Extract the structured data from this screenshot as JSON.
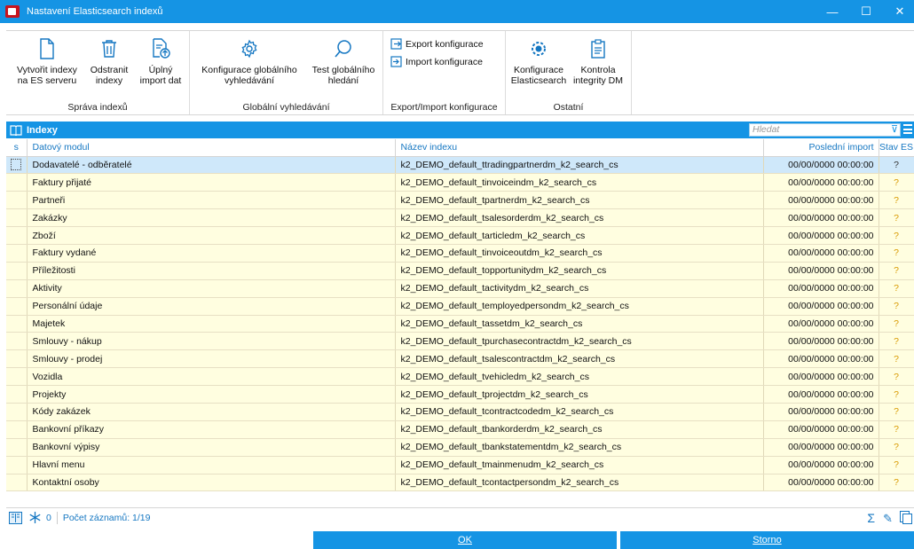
{
  "window": {
    "title": "Nastavení Elasticsearch indexů",
    "minimize": "—",
    "maximize": "☐",
    "close": "✕"
  },
  "ribbon": {
    "groups": [
      {
        "label": "Správa indexů",
        "buttons": [
          "Vytvořit indexy\nna ES serveru",
          "Odstranit\nindexy",
          "Úplný\nimport dat"
        ]
      },
      {
        "label": "Globální vyhledávání",
        "buttons": [
          "Konfigurace globálního\nvyhledávání",
          "Test globálního\nhledání"
        ]
      },
      {
        "label": "Export/Import konfigurace",
        "buttons": [
          "Export konfigurace",
          "Import konfigurace"
        ]
      },
      {
        "label": "Ostatní",
        "buttons": [
          "Konfigurace\nElasticsearch",
          "Kontrola\nintegrity DM"
        ]
      }
    ]
  },
  "grid": {
    "title": "Indexy",
    "search_placeholder": "Hledat",
    "columns": [
      "s",
      "Datový modul",
      "Název indexu",
      "Poslední import",
      "Stav ES"
    ],
    "rows": [
      {
        "modul": "Dodavatelé - odběratelé",
        "index": "k2_DEMO_default_ttradingpartnerdm_k2_search_cs",
        "import": "00/00/0000 00:00:00",
        "stav": "?"
      },
      {
        "modul": "Faktury přijaté",
        "index": "k2_DEMO_default_tinvoiceindm_k2_search_cs",
        "import": "00/00/0000 00:00:00",
        "stav": "?"
      },
      {
        "modul": "Partneři",
        "index": "k2_DEMO_default_tpartnerdm_k2_search_cs",
        "import": "00/00/0000 00:00:00",
        "stav": "?"
      },
      {
        "modul": "Zakázky",
        "index": "k2_DEMO_default_tsalesorderdm_k2_search_cs",
        "import": "00/00/0000 00:00:00",
        "stav": "?"
      },
      {
        "modul": "Zboží",
        "index": "k2_DEMO_default_tarticledm_k2_search_cs",
        "import": "00/00/0000 00:00:00",
        "stav": "?"
      },
      {
        "modul": "Faktury vydané",
        "index": "k2_DEMO_default_tinvoiceoutdm_k2_search_cs",
        "import": "00/00/0000 00:00:00",
        "stav": "?"
      },
      {
        "modul": "Příležitosti",
        "index": "k2_DEMO_default_topportunitydm_k2_search_cs",
        "import": "00/00/0000 00:00:00",
        "stav": "?"
      },
      {
        "modul": "Aktivity",
        "index": "k2_DEMO_default_tactivitydm_k2_search_cs",
        "import": "00/00/0000 00:00:00",
        "stav": "?"
      },
      {
        "modul": "Personální údaje",
        "index": "k2_DEMO_default_temployedpersondm_k2_search_cs",
        "import": "00/00/0000 00:00:00",
        "stav": "?"
      },
      {
        "modul": "Majetek",
        "index": "k2_DEMO_default_tassetdm_k2_search_cs",
        "import": "00/00/0000 00:00:00",
        "stav": "?"
      },
      {
        "modul": "Smlouvy - nákup",
        "index": "k2_DEMO_default_tpurchasecontractdm_k2_search_cs",
        "import": "00/00/0000 00:00:00",
        "stav": "?"
      },
      {
        "modul": "Smlouvy - prodej",
        "index": "k2_DEMO_default_tsalescontractdm_k2_search_cs",
        "import": "00/00/0000 00:00:00",
        "stav": "?"
      },
      {
        "modul": "Vozidla",
        "index": "k2_DEMO_default_tvehicledm_k2_search_cs",
        "import": "00/00/0000 00:00:00",
        "stav": "?"
      },
      {
        "modul": "Projekty",
        "index": "k2_DEMO_default_tprojectdm_k2_search_cs",
        "import": "00/00/0000 00:00:00",
        "stav": "?"
      },
      {
        "modul": "Kódy zakázek",
        "index": "k2_DEMO_default_tcontractcodedm_k2_search_cs",
        "import": "00/00/0000 00:00:00",
        "stav": "?"
      },
      {
        "modul": "Bankovní příkazy",
        "index": "k2_DEMO_default_tbankorderdm_k2_search_cs",
        "import": "00/00/0000 00:00:00",
        "stav": "?"
      },
      {
        "modul": "Bankovní výpisy",
        "index": "k2_DEMO_default_tbankstatementdm_k2_search_cs",
        "import": "00/00/0000 00:00:00",
        "stav": "?"
      },
      {
        "modul": "Hlavní menu",
        "index": "k2_DEMO_default_tmainmenudm_k2_search_cs",
        "import": "00/00/0000 00:00:00",
        "stav": "?"
      },
      {
        "modul": "Kontaktní osoby",
        "index": "k2_DEMO_default_tcontactpersondm_k2_search_cs",
        "import": "00/00/0000 00:00:00",
        "stav": "?"
      }
    ]
  },
  "status": {
    "selected_count": "0",
    "records": "Počet záznamů: 1/19"
  },
  "buttons": {
    "ok": "OK",
    "cancel": "Storno"
  },
  "colors": {
    "accent": "#1594e4",
    "row_bg": "#fffee0",
    "selected_bg": "#cfe8fa"
  }
}
